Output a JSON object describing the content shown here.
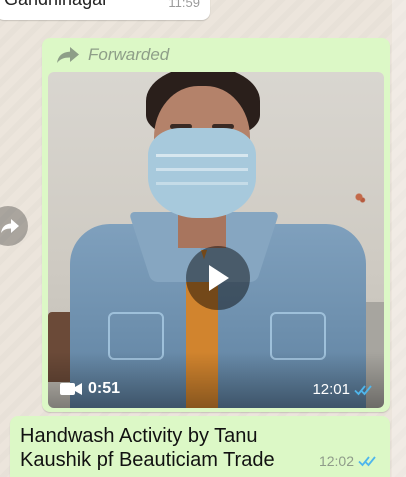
{
  "previous_message": {
    "text": "Gandhinagar",
    "time": "11:59"
  },
  "forwarded_message": {
    "forwarded_label": "Forwarded",
    "forward_icon": "forward-arrow-icon",
    "video": {
      "duration": "0:51",
      "time": "12:01",
      "status_icon": "double-check-icon",
      "play_icon": "play-icon"
    }
  },
  "caption_message": {
    "text": "Handwash Activity by Tanu Kaushik pf Beauticiam Trade",
    "time": "12:02",
    "status_icon": "double-check-icon"
  },
  "colors": {
    "outgoing_bubble": "#dcf8c6",
    "read_tick": "#4fb6ec",
    "chat_background": "#ece5dc"
  }
}
